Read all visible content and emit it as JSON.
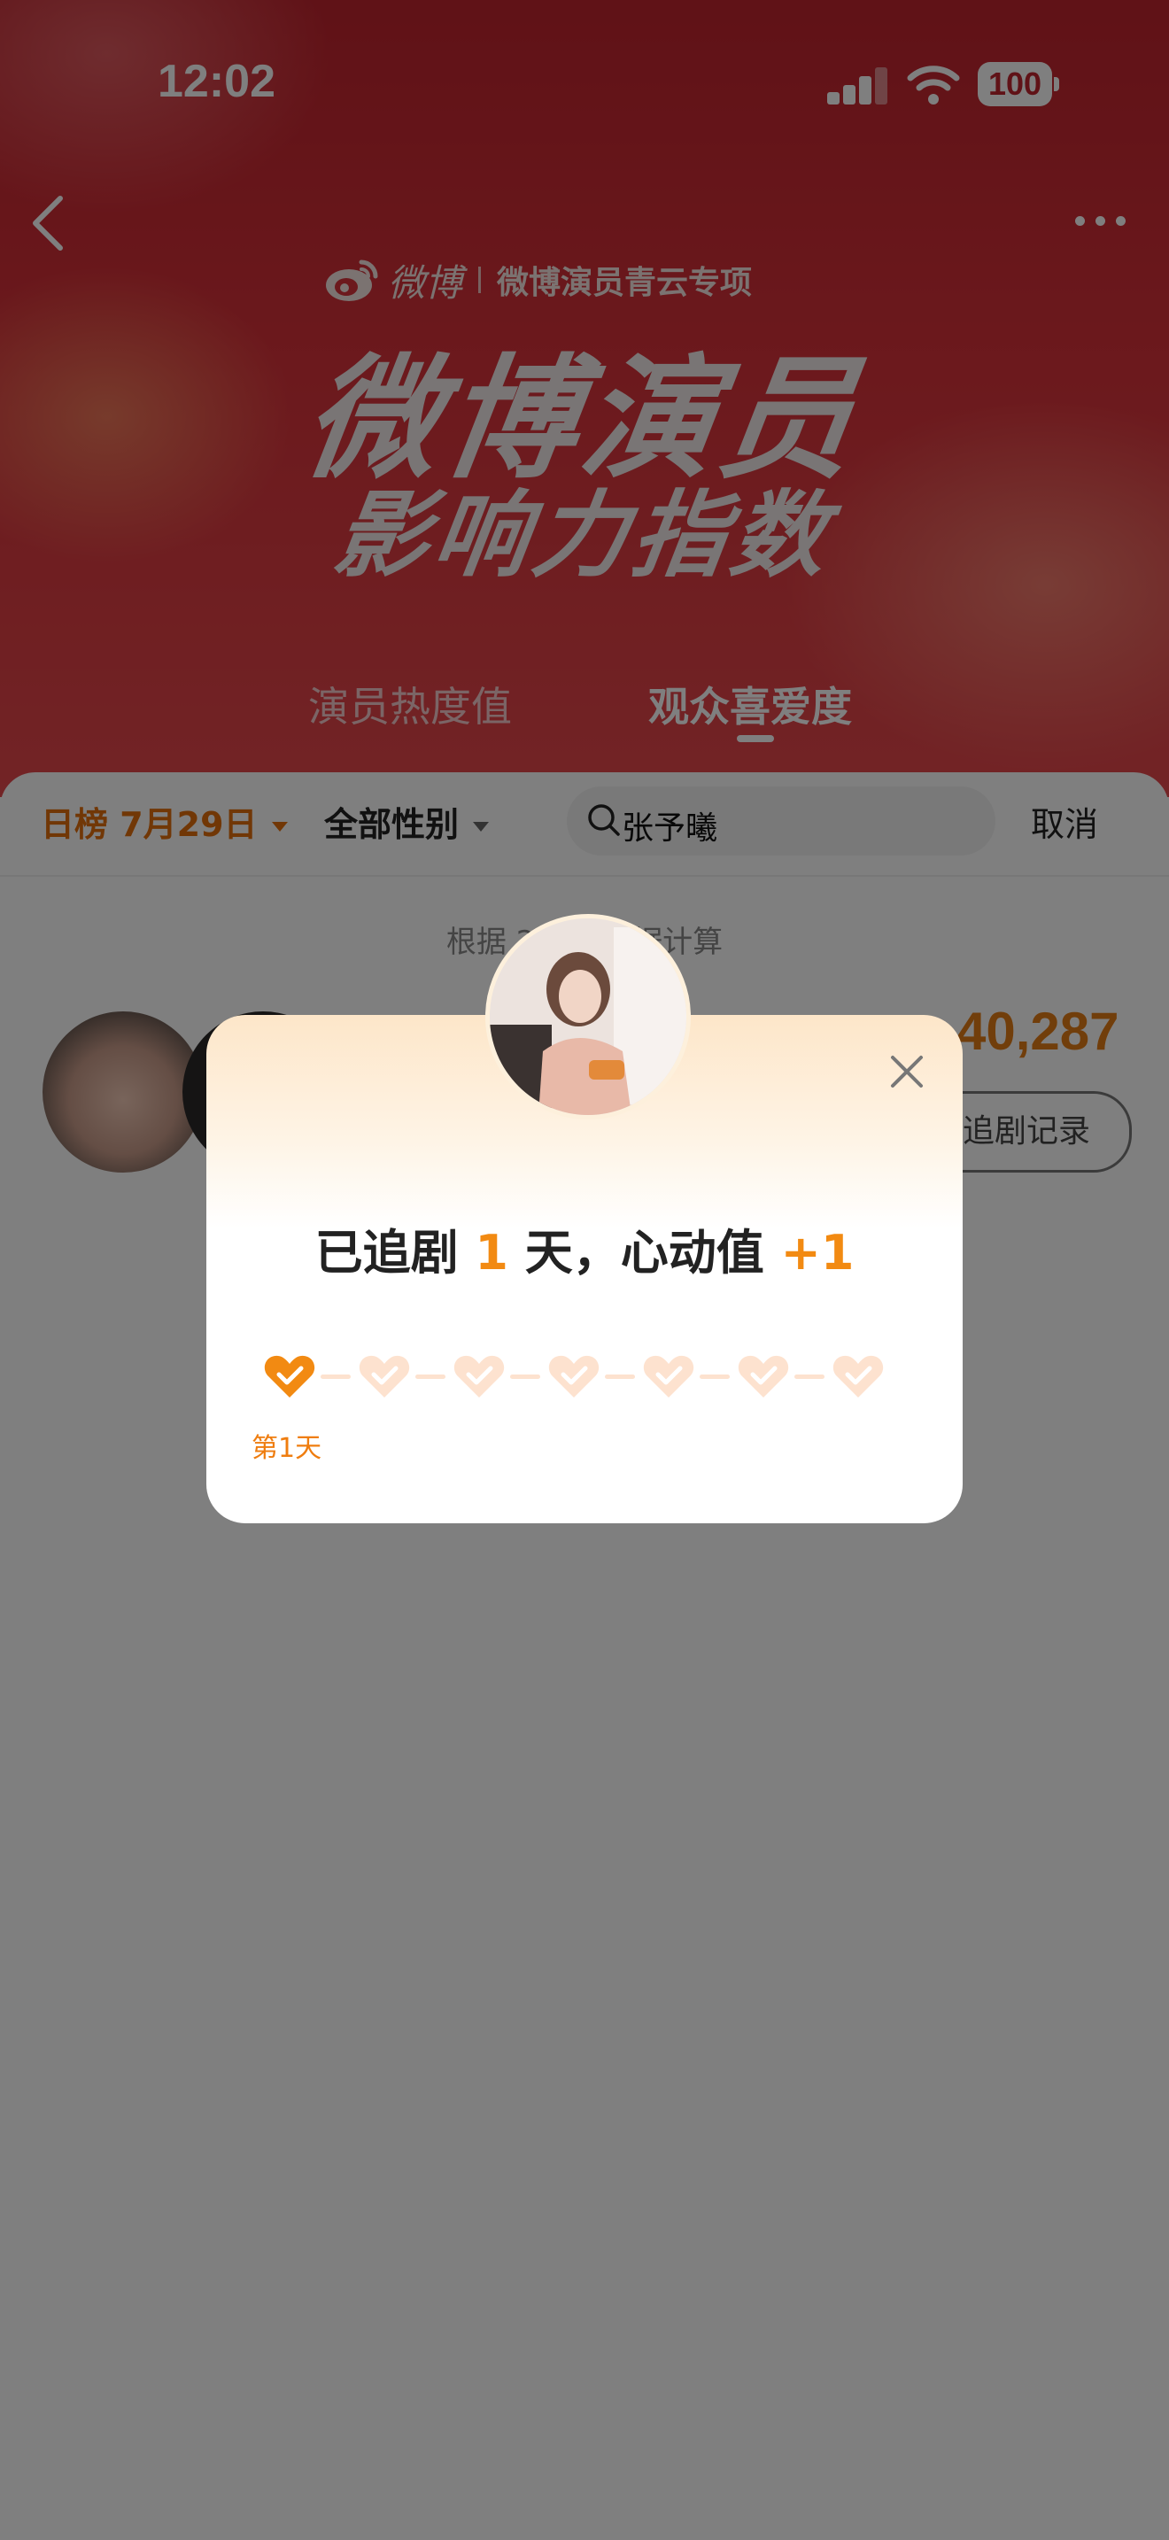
{
  "status_bar": {
    "time": "12:02",
    "battery": "100"
  },
  "header": {
    "brand": "微博",
    "brand_sub": "微博演员青云专项",
    "title_line1": "微博演员",
    "title_line2": "影响力指数",
    "tabs": [
      {
        "label": "演员热度值",
        "active": false
      },
      {
        "label": "观众喜爱度",
        "active": true
      }
    ]
  },
  "filters": {
    "daily_label": "日榜 7月29日",
    "gender_label": "全部性别",
    "search_value": "张予曦",
    "cancel_label": "取消"
  },
  "basis_text": "根据 2024 数据计算",
  "ranking_row": {
    "score": "40,287",
    "record_button": "追剧记录"
  },
  "popup": {
    "text_prefix": "已追剧",
    "days": "1",
    "text_mid": "天，心动值",
    "bonus": "+1",
    "day_label": "第1天",
    "total_days": 7,
    "completed_days": 1
  },
  "colors": {
    "accent_orange": "#f28a12",
    "hero_red": "#d8323a",
    "heart_inactive": "#fde2cf"
  }
}
